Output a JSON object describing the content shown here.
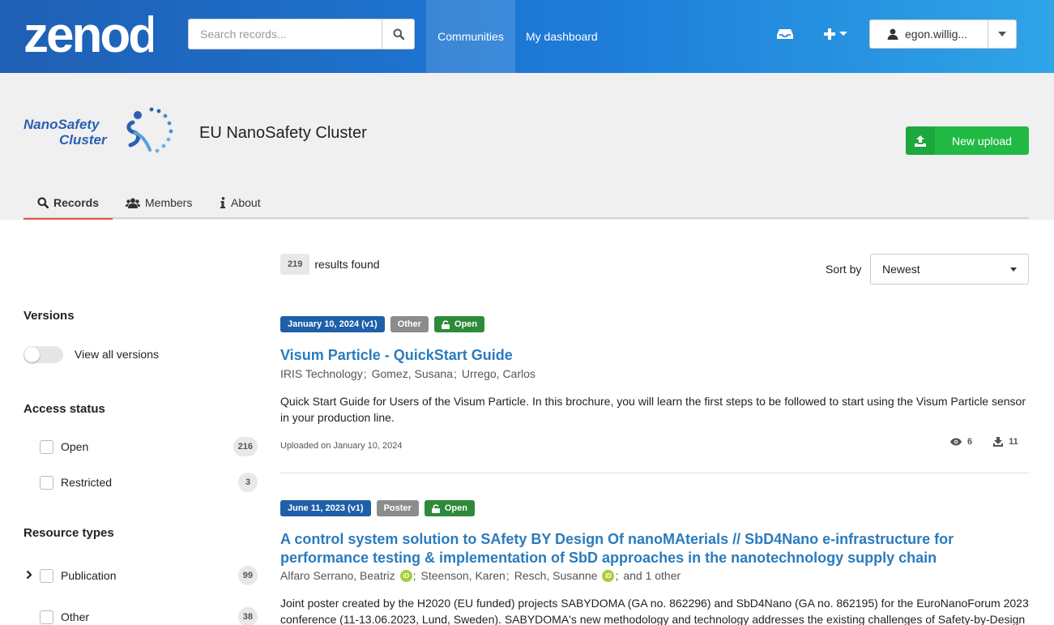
{
  "header": {
    "logo": "zenodo",
    "search": {
      "placeholder": "Search records..."
    },
    "nav": {
      "communities": "Communities",
      "dashboard": "My dashboard"
    },
    "user": {
      "name": "egon.willig..."
    }
  },
  "community": {
    "logo_text": [
      "NanoSafety",
      "Cluster"
    ],
    "title": "EU NanoSafety Cluster",
    "upload_label": "New upload"
  },
  "tabs": [
    {
      "label": "Records",
      "icon": "search-icon",
      "active": true
    },
    {
      "label": "Members",
      "icon": "users-icon",
      "active": false
    },
    {
      "label": "About",
      "icon": "info-icon",
      "active": false
    }
  ],
  "sidebar": {
    "versions": {
      "title": "Versions",
      "toggle_label": "View all versions"
    },
    "access": {
      "title": "Access status",
      "items": [
        {
          "name": "Open",
          "count": "216"
        },
        {
          "name": "Restricted",
          "count": "3"
        }
      ]
    },
    "resource_types": {
      "title": "Resource types",
      "items": [
        {
          "name": "Publication",
          "count": "99"
        },
        {
          "name": "Other",
          "count": "38"
        }
      ]
    }
  },
  "results": {
    "count": "219",
    "count_text": "results found",
    "sort_label": "Sort by",
    "sort_value": "Newest"
  },
  "records": [
    {
      "date": "January 10, 2024 (v1)",
      "type": "Other",
      "access": "Open",
      "title": "Visum Particle - QuickStart Guide",
      "authors": [
        "IRIS Technology",
        "Gomez, Susana",
        "Urrego, Carlos"
      ],
      "description": "Quick Start Guide for Users of the Visum Particle. In this brochure, you will learn the first steps to be followed to start using the Visum Particle sensor in your production line.",
      "uploaded": "Uploaded on January 10, 2024",
      "views": "6",
      "downloads": "11"
    },
    {
      "date": "June 11, 2023 (v1)",
      "type": "Poster",
      "access": "Open",
      "title_line1": "A control system solution to SAfety BY Design Of nanoMAterials // SbD4Nano e-infrastructure for",
      "title_line2": "performance testing & implementation of SbD approaches in the nanotechnology supply chain",
      "authors": [
        "Alfaro Serrano, Beatriz",
        "Steenson, Karen",
        "Resch, Susanne"
      ],
      "authors_more": "and 1 other",
      "orcid": "iD",
      "description_line1": "Joint poster created by the H2020 (EU funded) projects SABYDOMA (GA no. 862296) and SbD4Nano (GA no. 862195) for the EuroNanoForum 2023",
      "description_line2": "conference (11-13.06.2023, Lund, Sweden). SABYDOMA's new methodology and technology addresses the existing challenges of Safety-by-Design"
    }
  ]
}
